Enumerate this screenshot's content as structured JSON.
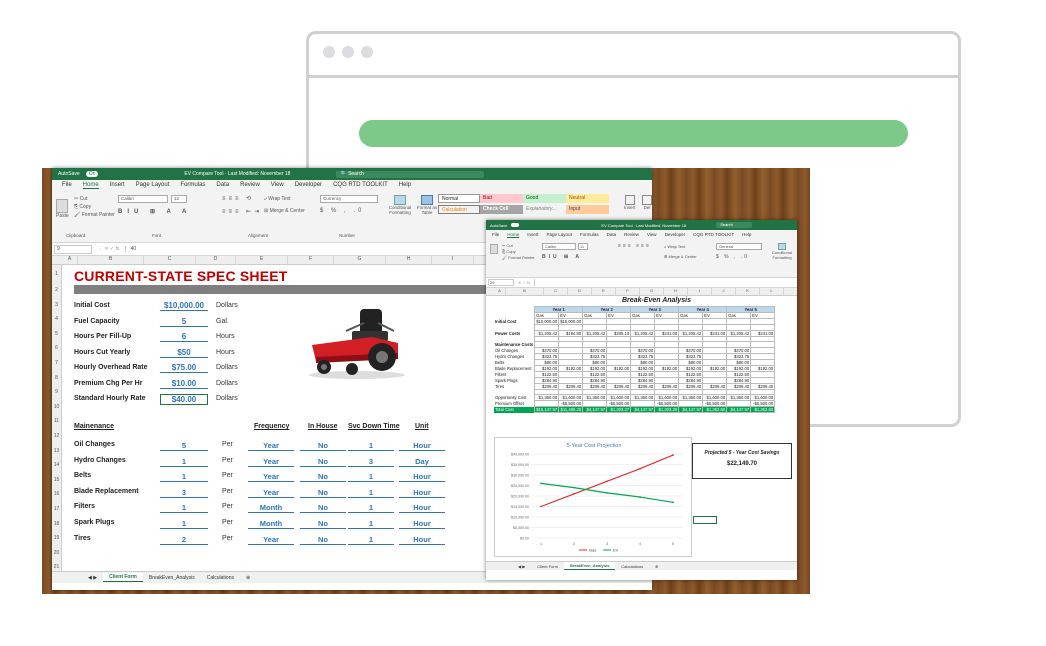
{
  "colors": {
    "excel_green": "#217346",
    "title_red": "#c00000",
    "value_blue": "#2e75b6",
    "pill_green": "#7dc98a"
  },
  "window1": {
    "autosave": "AutoSave",
    "autosave_state": "On",
    "title": "EV Compare Tool · Last Modified: November 18",
    "search": "Search",
    "menu": [
      "File",
      "Home",
      "Insert",
      "Page Layout",
      "Formulas",
      "Data",
      "Review",
      "View",
      "Developer",
      "CQG RTD TOOLKIT",
      "Help"
    ],
    "ribbon": {
      "cut": "Cut",
      "copy": "Copy",
      "format_painter": "Format Painter",
      "paste": "Paste",
      "font": "Calibri",
      "size": "12",
      "wrap": "Wrap Text",
      "merge": "Merge & Center",
      "number_format": "Currency",
      "cond_format": "Conditional Formatting",
      "format_table": "Format as Table",
      "styles": [
        "Normal",
        "Bad",
        "Good",
        "Neutral",
        "Calculation",
        "Check Cell",
        "Explanatory...",
        "Input"
      ],
      "insert": "Insert",
      "delete": "Del",
      "groups": [
        "Clipboard",
        "Font",
        "Alignment",
        "Number"
      ]
    },
    "name_box": "9",
    "formula": "40",
    "cols": [
      "A",
      "B",
      "C",
      "D",
      "E",
      "F",
      "G",
      "H",
      "I"
    ],
    "sheet_title": "CURRENT-STATE SPEC SHEET",
    "specs": [
      {
        "label": "Initial Cost",
        "value": "$10,000.00",
        "unit": "Dollars"
      },
      {
        "label": "Fuel Capacity",
        "value": "5",
        "unit": "Gal."
      },
      {
        "label": "Hours Per Fill-Up",
        "value": "6",
        "unit": "Hours"
      },
      {
        "label": "Hours Cut Yearly",
        "value": "$50",
        "unit": "Hours"
      },
      {
        "label": "Hourly Overhead Rate",
        "value": "$75.00",
        "unit": "Dollars"
      },
      {
        "label": "Premium Chg Per Hr",
        "value": "$10.00",
        "unit": "Dollars"
      },
      {
        "label": "Standard Hourly Rate",
        "value": "$40.00",
        "unit": "Dollars"
      }
    ],
    "maint_header": "Mainenance",
    "col_headers": {
      "frequency": "Frequency",
      "in_house": "In House",
      "svc": "Svc Down Time",
      "unit": "Unit"
    },
    "maint": [
      {
        "label": "Oil Changes",
        "qty": "1",
        "per": "Per",
        "freq": "Year",
        "inhouse": "No",
        "svc": "1",
        "unit": "Hour"
      },
      {
        "label": "Hydro Changes",
        "qty": "1",
        "per": "Per",
        "freq": "Year",
        "inhouse": "No",
        "svc": "3",
        "unit": "Day"
      },
      {
        "label": "Belts",
        "qty": "1",
        "per": "Per",
        "freq": "Year",
        "inhouse": "No",
        "svc": "1",
        "unit": "Hour"
      },
      {
        "label": "Blade Replacement",
        "qty": "3",
        "per": "Per",
        "freq": "Year",
        "inhouse": "No",
        "svc": "1",
        "unit": "Hour"
      },
      {
        "label": "Filters",
        "qty": "1",
        "per": "Per",
        "freq": "Month",
        "inhouse": "No",
        "svc": "1",
        "unit": "Hour"
      },
      {
        "label": "Spark Plugs",
        "qty": "1",
        "per": "Per",
        "freq": "Month",
        "inhouse": "No",
        "svc": "1",
        "unit": "Hour"
      },
      {
        "label": "Tires",
        "qty": "2",
        "per": "Per",
        "freq": "Year",
        "inhouse": "No",
        "svc": "1",
        "unit": "Hour"
      }
    ],
    "maint_qty_first": "5",
    "tabs": [
      "Client Form",
      "BreakEven_Analysis",
      "Calculations"
    ]
  },
  "window2": {
    "autosave": "AutoSave",
    "title": "EV Compare Tool · Last Modified: November 18",
    "search": "Search",
    "menu": [
      "File",
      "Home",
      "Insert",
      "Page Layout",
      "Formulas",
      "Data",
      "Review",
      "View",
      "Developer",
      "CQG RTD TOOLKIT",
      "Help"
    ],
    "font": "Calibri",
    "size": "11",
    "number_format": "General",
    "wrap": "Wrap Text",
    "merge": "Merge & Center",
    "cond_format": "Conditional Formatting",
    "name_box": "29",
    "cols": [
      "A",
      "B",
      "C",
      "D",
      "E",
      "F",
      "G",
      "H",
      "I",
      "J",
      "K",
      "L"
    ],
    "sheet_title": "Break-Even Analysis",
    "years": [
      "Year 1",
      "Year 2",
      "Year 3",
      "Year 4",
      "Year 5"
    ],
    "sub": [
      "Gas",
      "EV"
    ],
    "rows": [
      {
        "label": "Initial Cost",
        "bold": true,
        "cells": [
          "$10,000.00",
          "$15,000.00",
          "",
          "",
          "",
          "",
          "",
          "",
          "",
          ""
        ]
      },
      {
        "label": "",
        "cells": [
          "",
          "",
          "",
          "",
          "",
          "",
          "",
          "",
          "",
          ""
        ]
      },
      {
        "label": "Power Costs",
        "bold": true,
        "cells": [
          "$1,205.42",
          "$184.80",
          "$1,205.42",
          "$205.10",
          "$1,205.42",
          "$231.00",
          "$1,205.42",
          "$231.00",
          "$1,205.42",
          "$231.00"
        ]
      },
      {
        "label": "",
        "cells": [
          "",
          "",
          "",
          "",
          "",
          "",
          "",
          "",
          "",
          ""
        ]
      },
      {
        "label": "Maintenance Costs",
        "bold": true,
        "cells": [
          "",
          "",
          "",
          "",
          "",
          "",
          "",
          "",
          "",
          ""
        ]
      },
      {
        "label": "Oil Changes",
        "cells": [
          "$370.00",
          "",
          "$370.00",
          "",
          "$370.00",
          "",
          "$370.00",
          "",
          "$370.00",
          ""
        ]
      },
      {
        "label": "Hydro Changes",
        "cells": [
          "$323.75",
          "",
          "$323.75",
          "",
          "$323.75",
          "",
          "$323.75",
          "",
          "$323.75",
          ""
        ]
      },
      {
        "label": "Belts",
        "cells": [
          "$80.00",
          "",
          "$80.00",
          "",
          "$80.00",
          "",
          "$80.00",
          "",
          "$80.00",
          ""
        ]
      },
      {
        "label": "Blade Replacement",
        "cells": [
          "$192.00",
          "$192.00",
          "$192.00",
          "$192.00",
          "$192.00",
          "$192.00",
          "$192.00",
          "$192.00",
          "$192.00",
          "$192.00"
        ]
      },
      {
        "label": "Filters",
        "cells": [
          "$122.50",
          "",
          "$122.50",
          "",
          "$122.50",
          "",
          "$122.50",
          "",
          "$122.50",
          ""
        ]
      },
      {
        "label": "Spark Plugs",
        "cells": [
          "$284.90",
          "",
          "$284.90",
          "",
          "$284.90",
          "",
          "$284.90",
          "",
          "$284.90",
          ""
        ]
      },
      {
        "label": "Tires",
        "cells": [
          "$209.40",
          "$209.40",
          "$209.40",
          "$209.40",
          "$209.40",
          "$209.40",
          "$209.40",
          "$209.40",
          "$209.40",
          "$209.40"
        ]
      },
      {
        "label": "",
        "cells": [
          "",
          "",
          "",
          "",
          "",
          "",
          "",
          "",
          "",
          ""
        ]
      },
      {
        "label": "Opportunity Cost",
        "cells": [
          "$1,360.00",
          "$1,600.00",
          "$1,360.00",
          "$1,600.00",
          "$1,360.00",
          "$1,600.00",
          "$1,360.00",
          "$1,600.00",
          "$1,360.00",
          "$1,600.00"
        ]
      },
      {
        "label": "Premium Offset",
        "cells": [
          "",
          "-$5,500.00",
          "",
          "-$5,500.00",
          "",
          "-$5,500.00",
          "",
          "-$5,500.00",
          "",
          "-$5,500.00"
        ]
      },
      {
        "label": "Total Cost",
        "total": true,
        "cells": [
          "$15,147.97",
          "$11,486.20",
          "$4,147.97",
          "$1,203.27",
          "$4,147.97",
          "$1,203.30",
          "$4,147.97",
          "$1,262.60",
          "$4,147.97",
          "$1,262.60"
        ]
      }
    ],
    "savings_label": "Projected 5 - Year Cost Savings",
    "savings_value": "$22,149.70",
    "tabs": [
      "Client Form",
      "BreakEven_Analysis",
      "Calculations"
    ]
  },
  "chart_data": {
    "type": "line",
    "title": "5-Year Cost Projection",
    "x": [
      1,
      2,
      3,
      4,
      5
    ],
    "series": [
      {
        "name": "Gas",
        "color": "#e03030",
        "values": [
          15000,
          21000,
          27000,
          33000,
          39500
        ]
      },
      {
        "name": "EV",
        "color": "#00a651",
        "values": [
          26000,
          24000,
          21500,
          19500,
          17000
        ]
      }
    ],
    "ylim": [
      10000,
      40000
    ],
    "yticks": [
      "$40,000.00",
      "$35,000.00",
      "$30,000.00",
      "$25,000.00",
      "$20,000.00",
      "$15,000.00",
      "$10,000.00",
      "$5,000.00",
      "$0.00"
    ],
    "legend": "bottom"
  }
}
